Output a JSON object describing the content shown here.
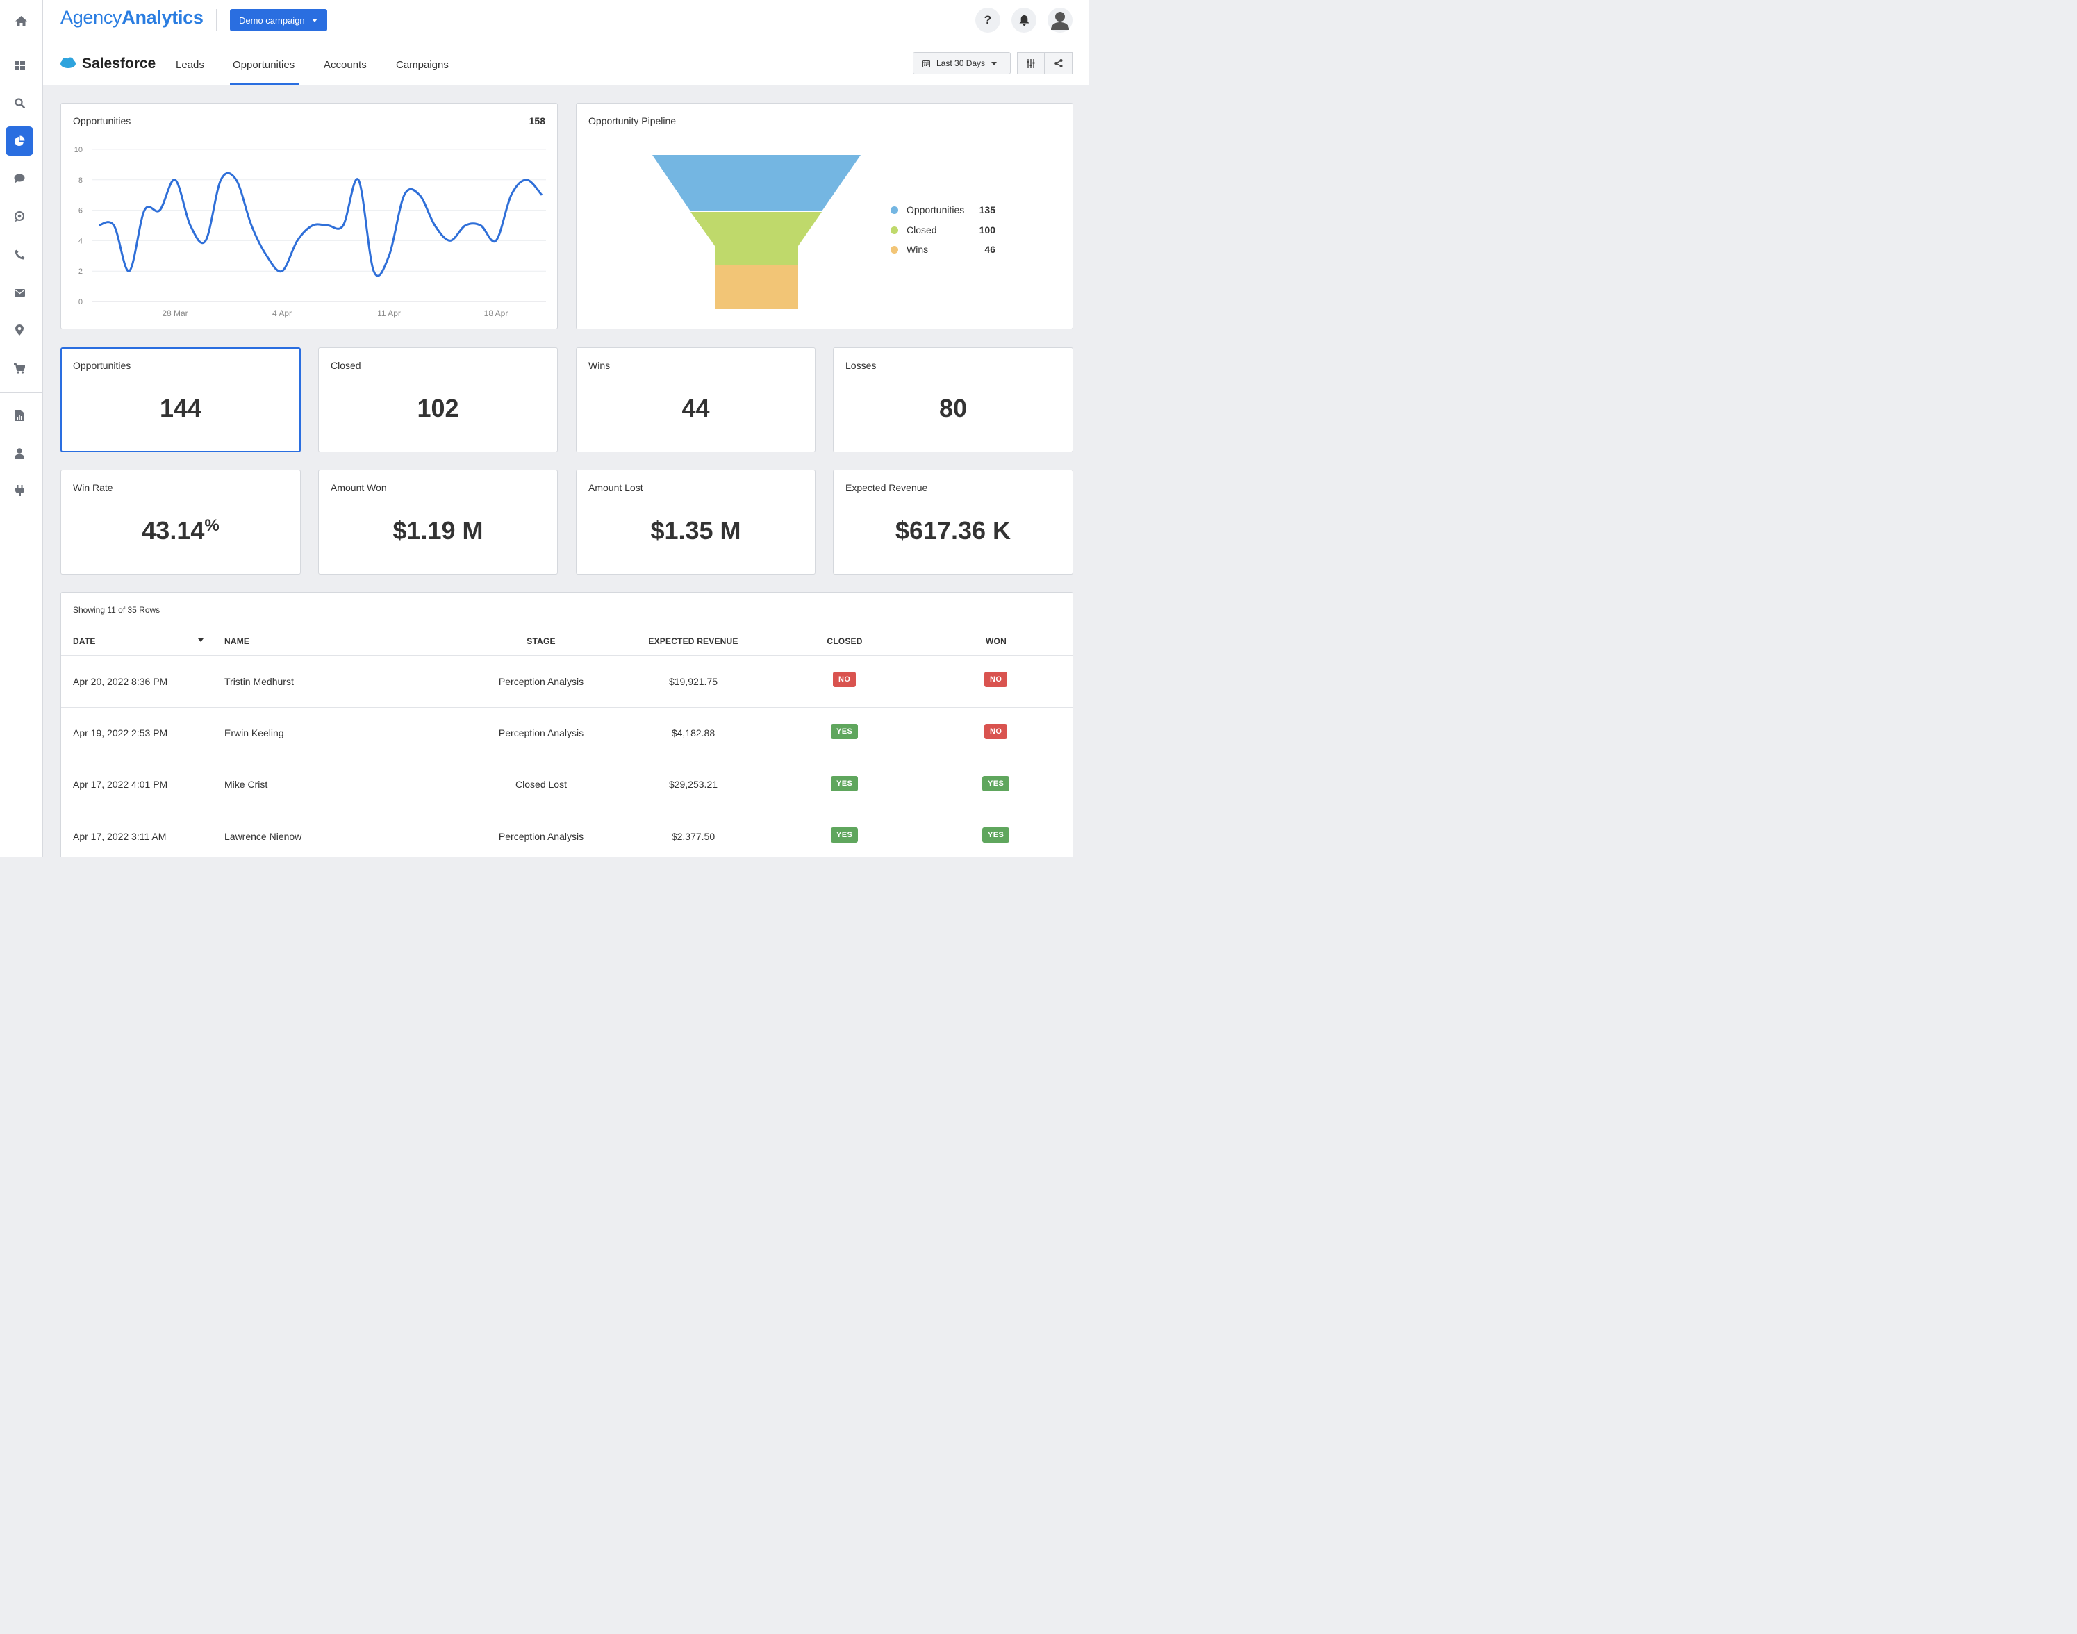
{
  "brand": {
    "logo_part1": "Agency",
    "logo_part2": "Analytics"
  },
  "campaign_selector": {
    "label": "Demo campaign"
  },
  "integration": {
    "name": "Salesforce"
  },
  "tabs": [
    {
      "label": "Leads"
    },
    {
      "label": "Opportunities"
    },
    {
      "label": "Accounts"
    },
    {
      "label": "Campaigns"
    }
  ],
  "active_tab": "Opportunities",
  "date_range": {
    "label": "Last 30 Days"
  },
  "top_icons": [
    "help-icon",
    "bell-icon",
    "user-avatar-icon"
  ],
  "sidebar_icons": [
    "home-icon",
    "dashboard-icon",
    "search-icon",
    "pie-chart-icon",
    "chat-icon",
    "social-icon",
    "phone-icon",
    "mail-icon",
    "location-pin-icon",
    "cart-icon",
    "report-icon",
    "user-icon",
    "plug-icon"
  ],
  "colors": {
    "accent": "#2a6ee0",
    "line": "#2f6fd8",
    "funnel_1": "#74b6e2",
    "funnel_2": "#bfd96b",
    "funnel_3": "#f2c576",
    "badge_no": "#d9534f",
    "badge_yes": "#5fa65d"
  },
  "opportunities_chart": {
    "title": "Opportunities",
    "total": "158",
    "y_ticks": [
      "0",
      "2",
      "4",
      "6",
      "8",
      "10"
    ],
    "x_ticks": [
      "28 Mar",
      "4 Apr",
      "11 Apr",
      "18 Apr"
    ]
  },
  "chart_data": [
    {
      "type": "line",
      "title": "Opportunities",
      "x": [
        "Mar 23",
        "Mar 24",
        "Mar 25",
        "Mar 26",
        "Mar 27",
        "Mar 28",
        "Mar 29",
        "Mar 30",
        "Mar 31",
        "Apr 1",
        "Apr 2",
        "Apr 3",
        "Apr 4",
        "Apr 5",
        "Apr 6",
        "Apr 7",
        "Apr 8",
        "Apr 9",
        "Apr 10",
        "Apr 11",
        "Apr 12",
        "Apr 13",
        "Apr 14",
        "Apr 15",
        "Apr 16",
        "Apr 17",
        "Apr 18",
        "Apr 19",
        "Apr 20",
        "Apr 21"
      ],
      "x_tick_labels": [
        "28 Mar",
        "4 Apr",
        "11 Apr",
        "18 Apr"
      ],
      "series": [
        {
          "values": [
            5,
            5,
            2,
            6,
            6,
            8,
            5,
            4,
            8,
            8,
            5,
            3,
            2,
            4,
            5,
            5,
            5,
            8,
            2,
            3,
            7,
            7,
            5,
            4,
            5,
            5,
            4,
            7,
            8,
            7
          ]
        }
      ],
      "ylim": [
        0,
        10
      ],
      "y_ticks": [
        0,
        2,
        4,
        6,
        8,
        10
      ],
      "grid": true
    },
    {
      "type": "funnel",
      "title": "Opportunity Pipeline",
      "categories": [
        "Opportunities",
        "Closed",
        "Wins"
      ],
      "values": [
        135,
        100,
        46
      ],
      "legend": "right"
    }
  ],
  "pipeline": {
    "title": "Opportunity Pipeline",
    "legend": [
      {
        "label": "Opportunities",
        "value": "135"
      },
      {
        "label": "Closed",
        "value": "100"
      },
      {
        "label": "Wins",
        "value": "46"
      }
    ]
  },
  "metrics": [
    {
      "label": "Opportunities",
      "value": "144"
    },
    {
      "label": "Closed",
      "value": "102"
    },
    {
      "label": "Wins",
      "value": "44"
    },
    {
      "label": "Losses",
      "value": "80"
    },
    {
      "label": "Win Rate",
      "value": "43.14",
      "unit": "%"
    },
    {
      "label": "Amount Won",
      "value": "$1.19 M"
    },
    {
      "label": "Amount Lost",
      "value": "$1.35 M"
    },
    {
      "label": "Expected Revenue",
      "value": "$617.36 K"
    }
  ],
  "table": {
    "showing": "Showing 11 of 35 Rows",
    "columns": [
      "DATE",
      "NAME",
      "STAGE",
      "EXPECTED REVENUE",
      "CLOSED",
      "WON"
    ],
    "rows": [
      {
        "date": "Apr 20, 2022 8:36 PM",
        "name": "Tristin Medhurst",
        "stage": "Perception Analysis",
        "revenue": "$19,921.75",
        "closed": "NO",
        "won": "NO"
      },
      {
        "date": "Apr 19, 2022 2:53 PM",
        "name": "Erwin Keeling",
        "stage": "Perception Analysis",
        "revenue": "$4,182.88",
        "closed": "YES",
        "won": "NO"
      },
      {
        "date": "Apr 17, 2022 4:01 PM",
        "name": "Mike Crist",
        "stage": "Closed Lost",
        "revenue": "$29,253.21",
        "closed": "YES",
        "won": "YES"
      },
      {
        "date": "Apr 17, 2022 3:11 AM",
        "name": "Lawrence Nienow",
        "stage": "Perception Analysis",
        "revenue": "$2,377.50",
        "closed": "YES",
        "won": "YES"
      }
    ]
  }
}
